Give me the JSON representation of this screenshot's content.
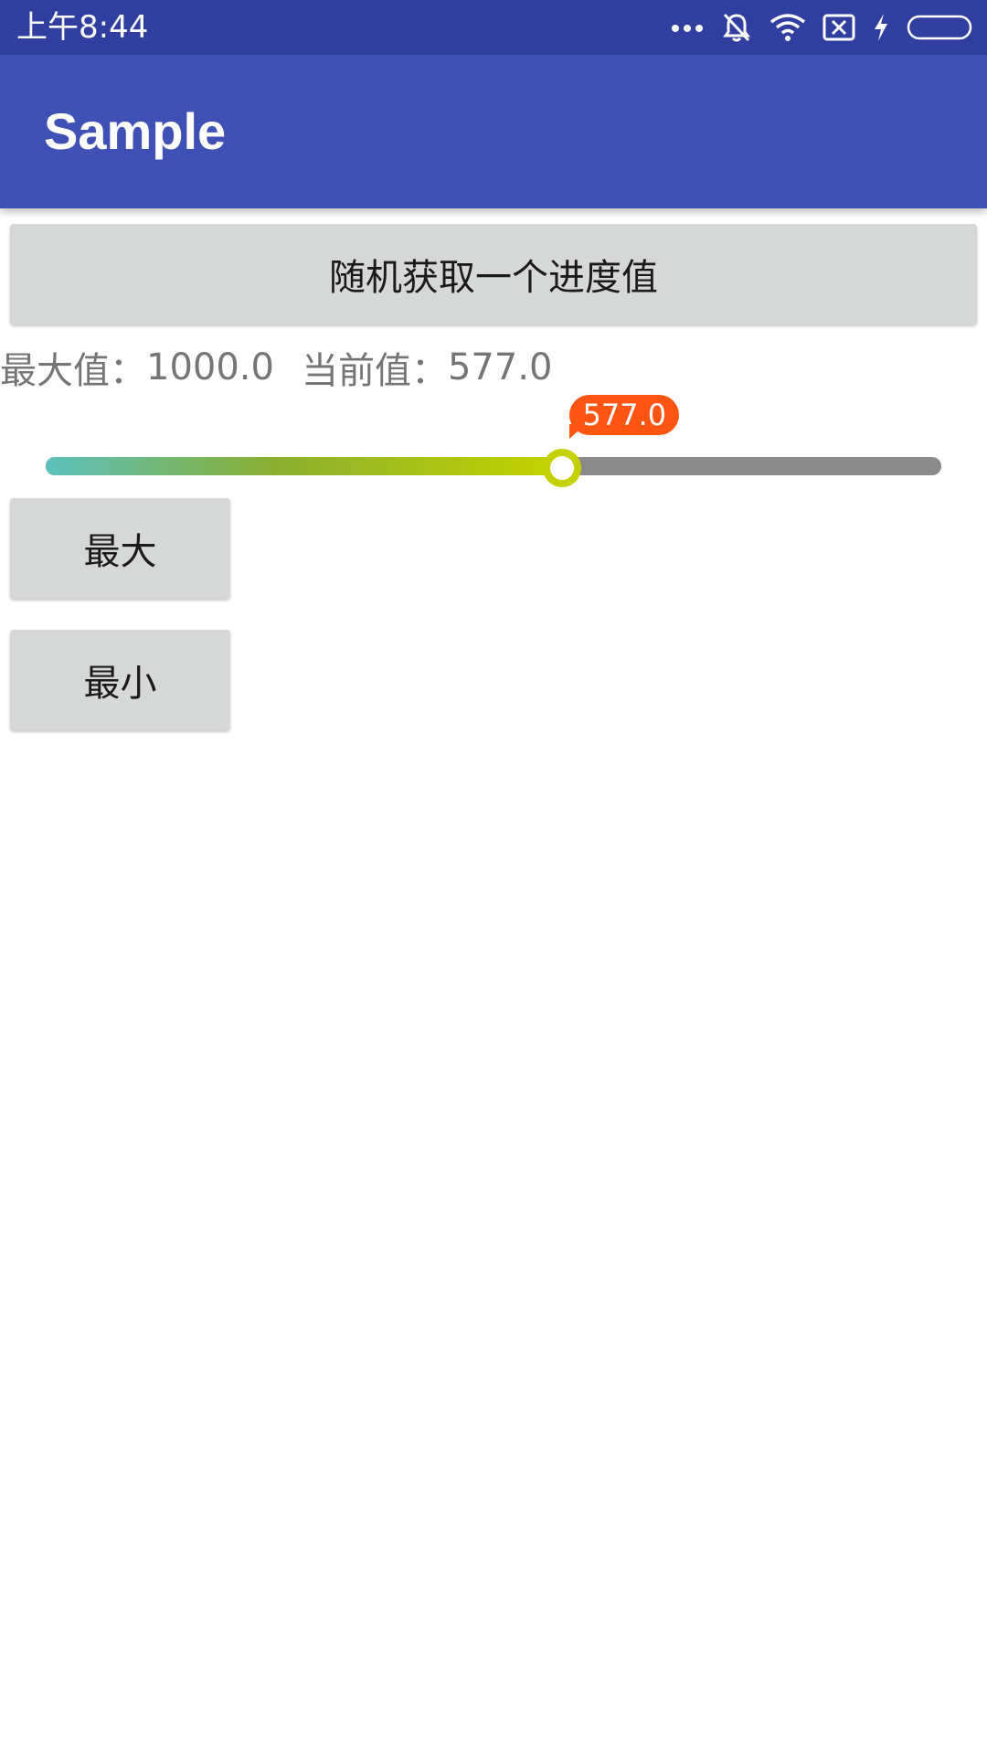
{
  "status_bar": {
    "time": "上午8:44",
    "icons": [
      "more-dots-icon",
      "mute-bell-icon",
      "wifi-icon",
      "sim-x-icon",
      "charging-bolt-icon",
      "battery-icon"
    ]
  },
  "app_bar": {
    "title": "Sample"
  },
  "buttons": {
    "random_label": "随机获取一个进度值",
    "max_label": "最大",
    "min_label": "最小"
  },
  "info": {
    "max_label": "最大值：",
    "max_value": "1000.0",
    "current_label": "当前值：",
    "current_value": "577.0"
  },
  "seekbar": {
    "max": 1000,
    "value": 577,
    "value_label": "577.0",
    "colors": {
      "fill_start": "#5BC0BE",
      "fill_end": "#C4D400",
      "track": "#8A8A8A",
      "thumb": "#C5D000",
      "bubble": "#FF5513"
    }
  },
  "colors": {
    "status_bar": "#303F9F",
    "app_bar": "#3F51B5",
    "button_bg": "#D6D7D7"
  }
}
